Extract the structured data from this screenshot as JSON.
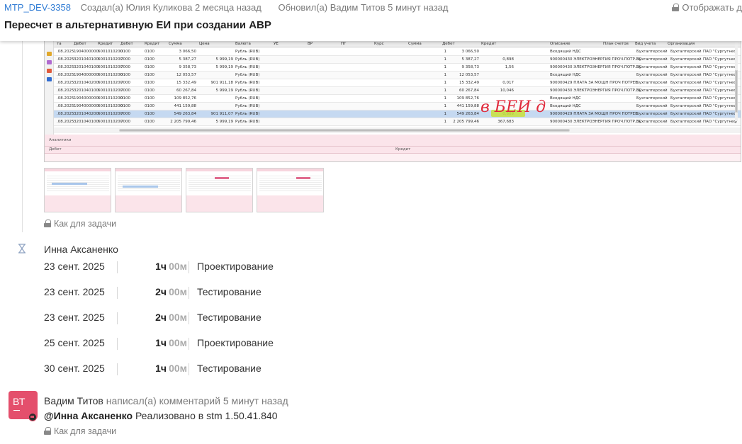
{
  "header": {
    "issue_key": "MTP_DEV-3358",
    "created": "Создал(а) Юлия Куликова 2 месяца назад",
    "updated": "Обновил(а) Вадим Титов 5 минут назад",
    "visibility": "Отображать д",
    "title": "Пересчет в альтернативную ЕИ при создании АВР"
  },
  "screenshot": {
    "columns": [
      "та",
      "Дебет",
      "Кредит",
      "Дебет",
      "Кредит",
      "Сумма",
      "Цена",
      "Валюта",
      "УЕ",
      "ВР",
      "ПГ",
      "Курс",
      "Сумма",
      "Дебет",
      "Кредит",
      "Описание",
      "План счетов",
      "Вид учета",
      "Организация"
    ],
    "rows": [
      {
        "date": ".08.2025",
        "dt": "1904000000",
        "kt": "6001010200",
        "d2": "0100",
        "k2": "0100",
        "sum": "3 066,50",
        "price": "",
        "cur": "Рубль (RUB)",
        "kurs": "1",
        "sum2": "3 066,50",
        "deb": "",
        "desc": "Входящий НДС",
        "plan": "Бухгалтерский",
        "vid": "Бухгалтерский",
        "org": "ПАО \"Сургутнеф"
      },
      {
        "date": ".08.2025",
        "dt": "3201040100",
        "kt": "6001010200",
        "d2": "7000",
        "k2": "0100",
        "sum": "5 387,27",
        "price": "5 999,19",
        "cur": "Рубль (RUB)",
        "kurs": "1",
        "sum2": "5 387,27",
        "deb": "0,898",
        "desc": "900000430 ЭЛЕКТРОЭНЕРГИЯ ПРОЧ.ПОТР.ЭС",
        "plan": "Бухгалтерский",
        "vid": "Бухгалтерский",
        "org": "ПАО \"Сургутнеф"
      },
      {
        "date": ".08.2025",
        "dt": "3201040100",
        "kt": "6001010200",
        "d2": "7000",
        "k2": "0100",
        "sum": "9 358,73",
        "price": "5 999,19",
        "cur": "Рубль (RUB)",
        "kurs": "1",
        "sum2": "9 358,73",
        "deb": "1,56",
        "desc": "900000430 ЭЛЕКТРОЭНЕРГИЯ ПРОЧ.ПОТР.ЭС",
        "plan": "Бухгалтерский",
        "vid": "Бухгалтерский",
        "org": "ПАО \"Сургутнеф"
      },
      {
        "date": ".08.2025",
        "dt": "1904000000",
        "kt": "6001010200",
        "d2": "0100",
        "k2": "0100",
        "sum": "12 053,57",
        "price": "",
        "cur": "Рубль (RUB)",
        "kurs": "1",
        "sum2": "12 053,57",
        "deb": "",
        "desc": "Входящий НДС",
        "plan": "Бухгалтерский",
        "vid": "Бухгалтерский",
        "org": "ПАО \"Сургутнеф"
      },
      {
        "date": ".08.2025",
        "dt": "3201040200",
        "kt": "6001010200",
        "d2": "7000",
        "k2": "0100",
        "sum": "15 332,49",
        "price": "901 911,18",
        "cur": "Рубль (RUB)",
        "kurs": "1",
        "sum2": "15 332,49",
        "deb": "0,017",
        "desc": "900000429 ПЛАТА ЗА МОЩН ПРОЧ ПОТРЕБ",
        "plan": "Бухгалтерский",
        "vid": "Бухгалтерский",
        "org": "ПАО \"Сургутнеф"
      },
      {
        "date": ".08.2025",
        "dt": "3201040100",
        "kt": "6001010200",
        "d2": "7000",
        "k2": "0100",
        "sum": "60 267,84",
        "price": "5 999,19",
        "cur": "Рубль (RUB)",
        "kurs": "1",
        "sum2": "60 267,84",
        "deb": "10,046",
        "desc": "900000430 ЭЛЕКТРОЭНЕРГИЯ ПРОЧ.ПОТР.ЭС",
        "plan": "Бухгалтерский",
        "vid": "Бухгалтерский",
        "org": "ПАО \"Сургутнеф"
      },
      {
        "date": ".08.2025",
        "dt": "1904000000",
        "kt": "6001010200",
        "d2": "0100",
        "k2": "0100",
        "sum": "109 852,76",
        "price": "",
        "cur": "Рубль (RUB)",
        "kurs": "1",
        "sum2": "109 852,76",
        "deb": "",
        "desc": "Входящий НДС",
        "plan": "Бухгалтерский",
        "vid": "Бухгалтерский",
        "org": "ПАО \"Сургутнеф"
      },
      {
        "date": ".08.2025",
        "dt": "1904000000",
        "kt": "6001010200",
        "d2": "0100",
        "k2": "0100",
        "sum": "441 159,88",
        "price": "",
        "cur": "Рубль (RUB)",
        "kurs": "1",
        "sum2": "441 159,88",
        "deb": "",
        "desc": "Входящий НДС",
        "plan": "Бухгалтерский",
        "vid": "Бухгалтерский",
        "org": "ПАО \"Сургутнеф"
      },
      {
        "date": ".08.2025",
        "dt": "3201040200",
        "kt": "6001010200",
        "d2": "7000",
        "k2": "0100",
        "sum": "549 263,84",
        "price": "901 911,07",
        "cur": "Рубль (RUB)",
        "kurs": "1",
        "sum2": "549 263,84",
        "deb": "0,609",
        "desc": "900000429 ПЛАТА ЗА МОЩН ПРОЧ ПОТРЕБ",
        "plan": "Бухгалтерский",
        "vid": "Бухгалтерский",
        "org": "ПАО \"Сургутнеф"
      },
      {
        "date": ".08.2025",
        "dt": "3201040100",
        "kt": "6001010200",
        "d2": "7000",
        "k2": "0100",
        "sum": "2 205 799,46",
        "price": "5 999,19",
        "cur": "Рубль (RUB)",
        "kurs": "1",
        "sum2": "2 205 799,46",
        "deb": "367,683",
        "desc": "900000430 ЭЛЕКТРОЭНЕРГИЯ ПРОЧ.ПОТР.ЭС",
        "plan": "Бухгалтерский",
        "vid": "Бухгалтерский",
        "org": "ПАО \"Сургутнеф"
      }
    ],
    "panel_label": "Аналитики",
    "panel_debit": "Дебет",
    "panel_credit": "Кредит",
    "handwriting": "в БЕИ д б"
  },
  "attachments_visibility": "Как для задачи",
  "worklog": {
    "author": "Инна Аксаненко",
    "entries": [
      {
        "date": "23 сент. 2025",
        "hours": "1ч",
        "minutes": "00м",
        "activity": "Проектирование"
      },
      {
        "date": "23 сент. 2025",
        "hours": "2ч",
        "minutes": "00м",
        "activity": "Тестирование"
      },
      {
        "date": "23 сент. 2025",
        "hours": "2ч",
        "minutes": "00м",
        "activity": "Тестирование"
      },
      {
        "date": "25 сент. 2025",
        "hours": "1ч",
        "minutes": "00м",
        "activity": "Проектирование"
      },
      {
        "date": "30 сент. 2025",
        "hours": "1ч",
        "minutes": "00м",
        "activity": "Тестирование"
      }
    ]
  },
  "comment": {
    "avatar_initials": "ВТ",
    "author": "Вадим Титов",
    "action": "написал(а) комментарий 5 минут назад",
    "mention": "@Инна Аксаненко",
    "text": "Реализовано в stm 1.50.41.840",
    "visibility": "Как для задачи"
  },
  "colors": {
    "accent_link": "#2f7bd4",
    "avatar_bg": "#e44f6c",
    "highlight": "#c8e03a",
    "pink_panel": "#fbe4ea"
  }
}
